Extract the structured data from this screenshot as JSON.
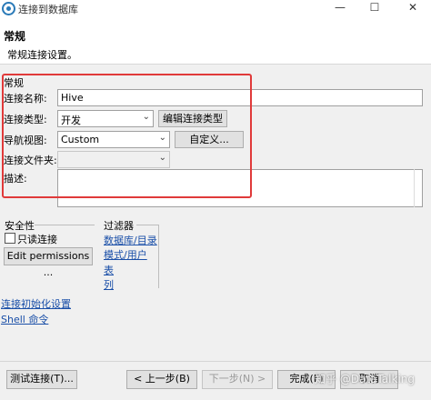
{
  "window": {
    "title": "连接到数据库",
    "controls": {
      "minimize": "—",
      "maximize": "☐",
      "close": "✕"
    }
  },
  "header": {
    "title": "常规",
    "description": "常规连接设置。"
  },
  "general": {
    "group_title": "常规",
    "connection_name_label": "连接名称:",
    "connection_name_value": "Hive",
    "connection_type_label": "连接类型:",
    "connection_type_value": "开发",
    "edit_connection_type_button": "编辑连接类型",
    "navigator_view_label": "导航视图:",
    "navigator_view_value": "Custom",
    "customize_button": "自定义...",
    "connection_folder_label": "连接文件夹:",
    "connection_folder_value": "",
    "description_label": "描述:",
    "description_value": ""
  },
  "security": {
    "title": "安全性",
    "readonly_label": "只读连接",
    "readonly_checked": false,
    "edit_permissions_button": "Edit permissions ..."
  },
  "filters": {
    "title": "过滤器",
    "links": [
      "数据库/目录",
      "模式/用户",
      "表",
      "列"
    ]
  },
  "links": {
    "init_settings": "连接初始化设置",
    "shell_commands": "Shell 命令"
  },
  "footer": {
    "test_connection": "测试连接(T)...",
    "back": "< 上一步(B)",
    "next": "下一步(N) >",
    "finish": "完成(F)",
    "cancel": "取消"
  },
  "watermark": "知乎 @DataTalking",
  "colors": {
    "highlight_box": "#e03a3a",
    "link": "#1a4fa8"
  }
}
